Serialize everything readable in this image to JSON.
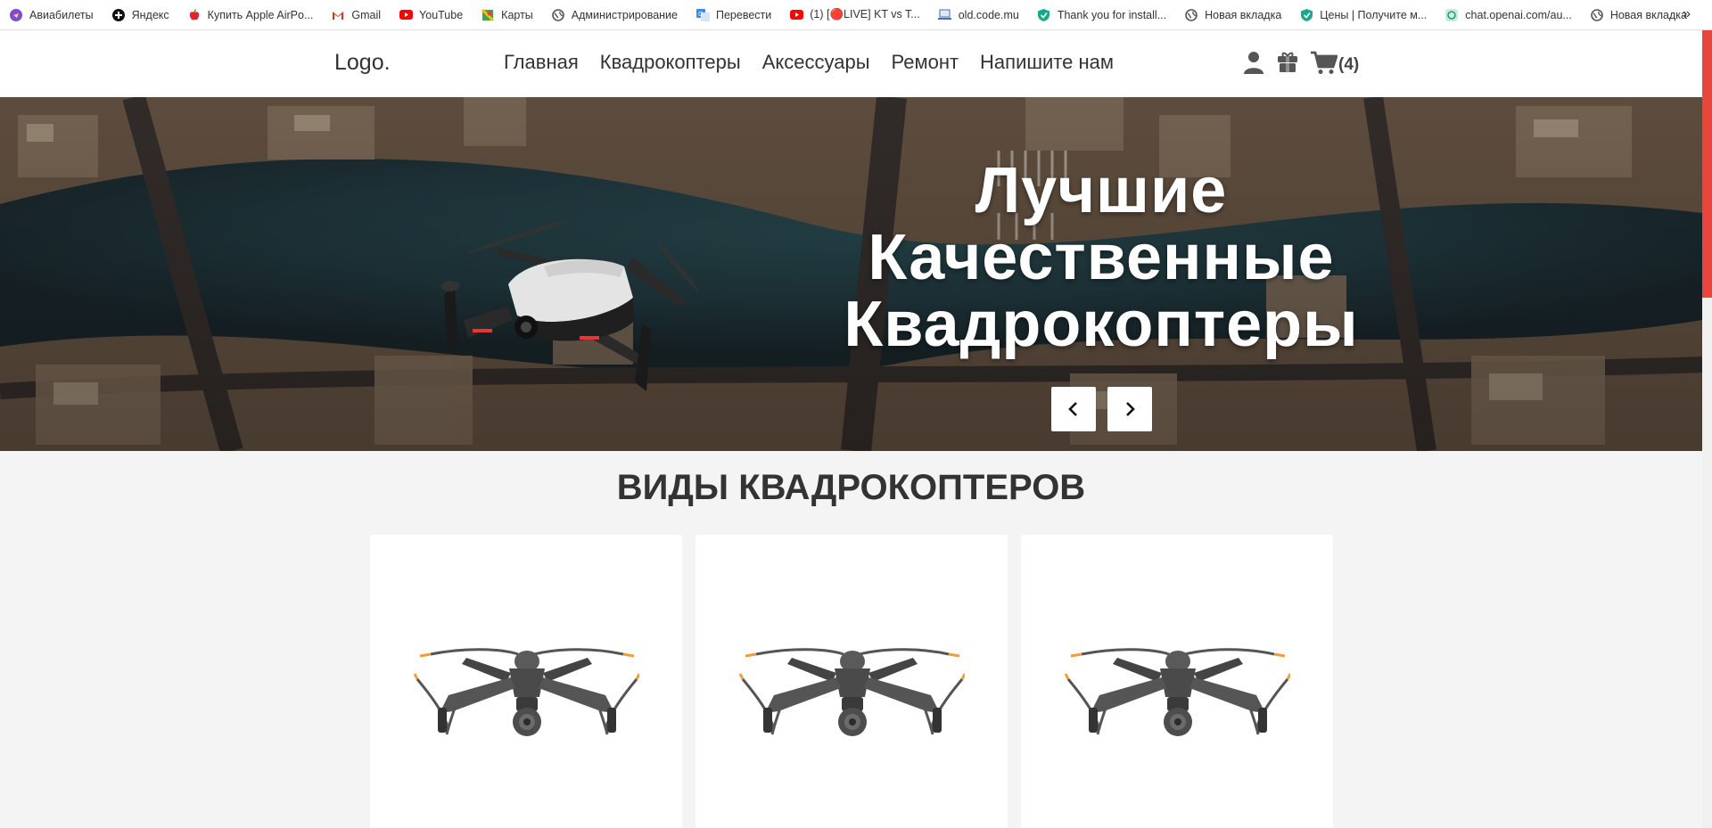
{
  "bookmarks": [
    {
      "label": "Авиабилеты",
      "icon": "travel-icon",
      "color": "#7b4dd8"
    },
    {
      "label": "Яндекс",
      "icon": "yandex-icon",
      "color": "#000000"
    },
    {
      "label": "Купить Apple AirPo...",
      "icon": "apple-icon",
      "color": "#e0262d"
    },
    {
      "label": "Gmail",
      "icon": "gmail-icon",
      "color": "#d93025"
    },
    {
      "label": "YouTube",
      "icon": "youtube-icon",
      "color": "#ff0000"
    },
    {
      "label": "Карты",
      "icon": "maps-icon",
      "color": "#34a853"
    },
    {
      "label": "Администрирование",
      "icon": "globe-icon",
      "color": "#555555"
    },
    {
      "label": "Перевести",
      "icon": "translate-icon",
      "color": "#4285f4"
    },
    {
      "label": "(1) [🔴LIVE] KT vs T...",
      "icon": "youtube-icon",
      "color": "#ff0000"
    },
    {
      "label": "old.code.mu",
      "icon": "laptop-icon",
      "color": "#4a6fa5"
    },
    {
      "label": "Thank you for install...",
      "icon": "shield-icon",
      "color": "#18a98a"
    },
    {
      "label": "Новая вкладка",
      "icon": "globe-icon",
      "color": "#555555"
    },
    {
      "label": "Цены | Получите м...",
      "icon": "shield-icon",
      "color": "#18a98a"
    },
    {
      "label": "chat.openai.com/au...",
      "icon": "openai-icon",
      "color": "#10a37f"
    },
    {
      "label": "Новая вкладка",
      "icon": "globe-icon",
      "color": "#555555"
    }
  ],
  "bookmarks_more": "»",
  "header": {
    "logo": "Logo.",
    "nav": [
      "Главная",
      "Квадрокоптеры",
      "Аксессуары",
      "Ремонт",
      "Напишите нам"
    ],
    "cart_count": "(4)"
  },
  "hero": {
    "title_lines": [
      "Лучшие",
      "Качественные",
      "Квадрокоптеры"
    ]
  },
  "section": {
    "title": "ВИДЫ КВАДРОКОПТЕРОВ",
    "cards": [
      {
        "image": "drone-image"
      },
      {
        "image": "drone-image"
      },
      {
        "image": "drone-image"
      }
    ]
  },
  "colors": {
    "accent": "#e8453c",
    "text": "#333333",
    "background": "#f4f4f4"
  }
}
